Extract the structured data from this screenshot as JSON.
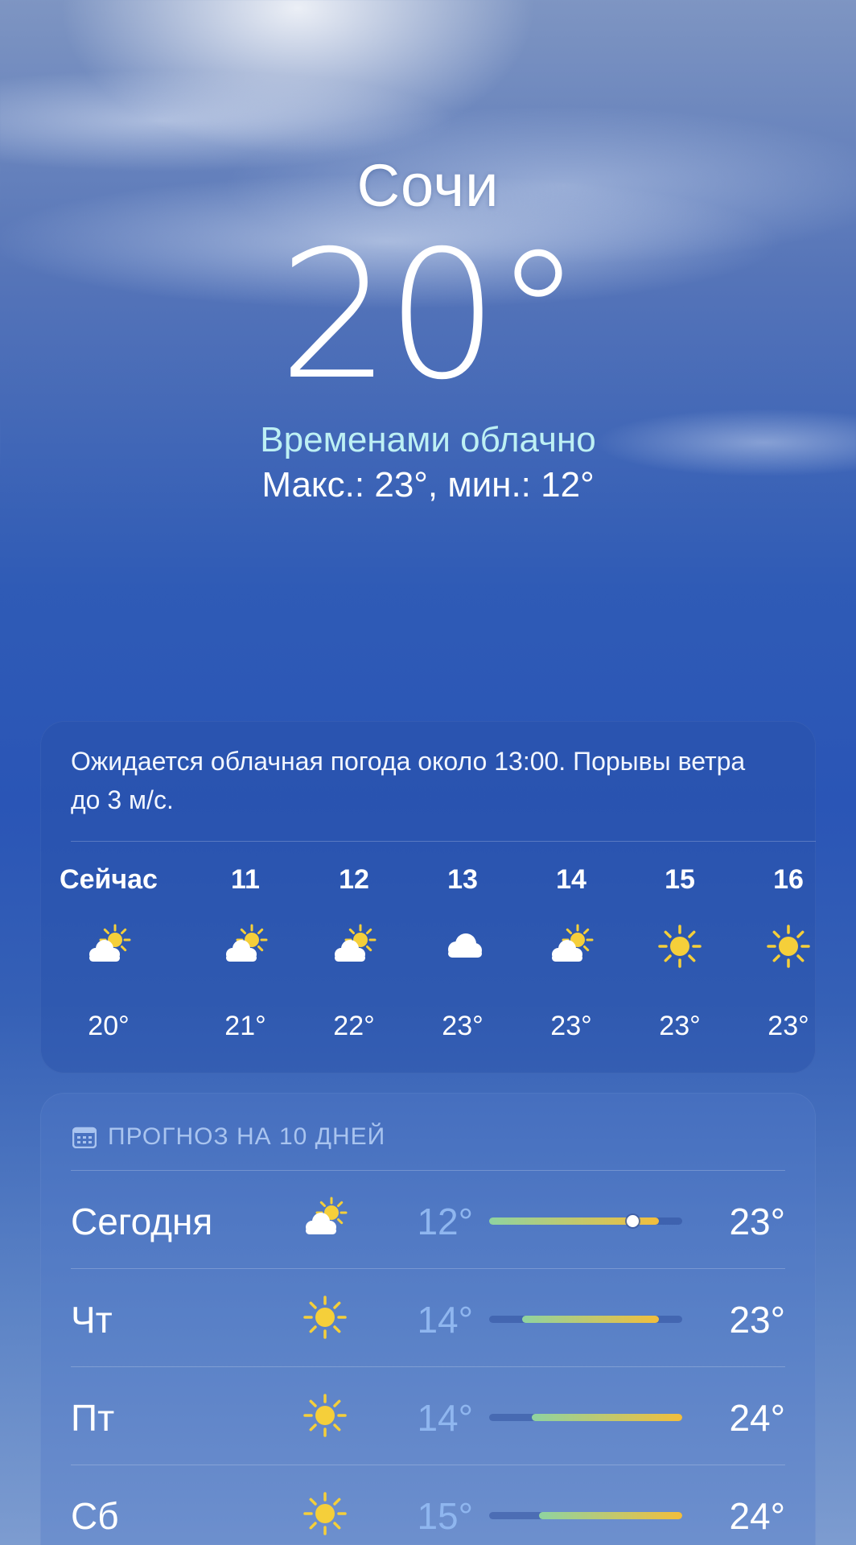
{
  "location": {
    "city": "Сочи",
    "temperature": "20°",
    "condition": "Временами облачно",
    "high_low": "Макс.: 23°, мин.: 12°"
  },
  "hourly": {
    "summary": "Ожидается облачная погода около 13:00. Порывы ветра до 3 м/с.",
    "hours": [
      {
        "label": "Сейчас",
        "icon": "partly-cloudy-icon",
        "temp": "20°"
      },
      {
        "label": "11",
        "icon": "partly-cloudy-icon",
        "temp": "21°"
      },
      {
        "label": "12",
        "icon": "partly-cloudy-icon",
        "temp": "22°"
      },
      {
        "label": "13",
        "icon": "cloud-icon",
        "temp": "23°"
      },
      {
        "label": "14",
        "icon": "partly-cloudy-icon",
        "temp": "23°"
      },
      {
        "label": "15",
        "icon": "sun-icon",
        "temp": "23°"
      },
      {
        "label": "16",
        "icon": "sun-icon",
        "temp": "23°"
      }
    ]
  },
  "daily": {
    "header": "ПРОГНОЗ НА 10 ДНЕЙ",
    "header_icon": "calendar-icon",
    "days": [
      {
        "name": "Сегодня",
        "icon": "partly-cloudy-icon",
        "min": "12°",
        "max": "23°",
        "range_start": 0.0,
        "range_end": 0.88,
        "current_pos": 0.74
      },
      {
        "name": "Чт",
        "icon": "sun-icon",
        "min": "14°",
        "max": "23°",
        "range_start": 0.17,
        "range_end": 0.88
      },
      {
        "name": "Пт",
        "icon": "sun-icon",
        "min": "14°",
        "max": "24°",
        "range_start": 0.22,
        "range_end": 1.0
      },
      {
        "name": "Сб",
        "icon": "sun-icon",
        "min": "15°",
        "max": "24°",
        "range_start": 0.26,
        "range_end": 1.0
      }
    ]
  },
  "colors": {
    "condition_text": "#bdf0f4",
    "min_temp_text": "#8fb6ef",
    "sun_yellow": "#f5cf3a",
    "bar_cool": "#8fd3a0",
    "bar_warm": "#f2be3c"
  }
}
